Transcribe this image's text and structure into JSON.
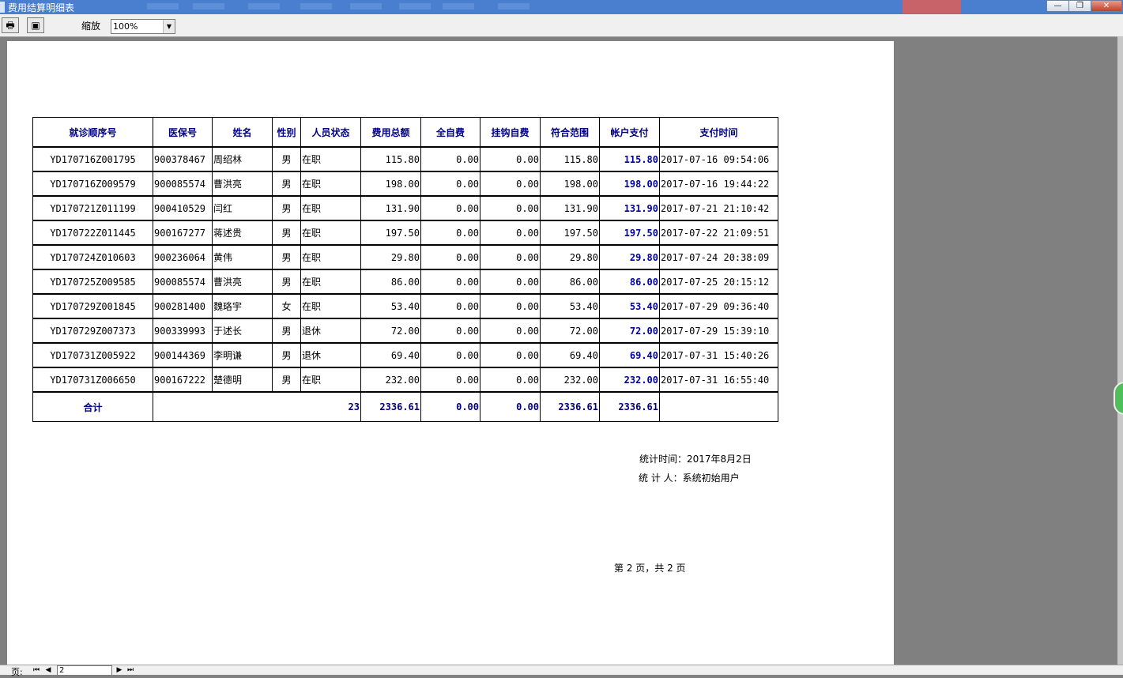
{
  "window": {
    "title": "费用结算明细表"
  },
  "toolbar": {
    "zoom_label": "缩放",
    "zoom_value": "100%"
  },
  "report": {
    "columns": [
      "就诊顺序号",
      "医保号",
      "姓名",
      "性别",
      "人员状态",
      "费用总额",
      "全自费",
      "挂钩自费",
      "符合范围",
      "帐户支付",
      "支付时间"
    ],
    "rows": [
      [
        "YD170716Z001795",
        "900378467",
        "周绍林",
        "男",
        "在职",
        "115.80",
        "0.00",
        "0.00",
        "115.80",
        "115.80",
        "2017-07-16 09:54:06"
      ],
      [
        "YD170716Z009579",
        "900085574",
        "曹洪亮",
        "男",
        "在职",
        "198.00",
        "0.00",
        "0.00",
        "198.00",
        "198.00",
        "2017-07-16 19:44:22"
      ],
      [
        "YD170721Z011199",
        "900410529",
        "闫红",
        "男",
        "在职",
        "131.90",
        "0.00",
        "0.00",
        "131.90",
        "131.90",
        "2017-07-21 21:10:42"
      ],
      [
        "YD170722Z011445",
        "900167277",
        "蒋述贵",
        "男",
        "在职",
        "197.50",
        "0.00",
        "0.00",
        "197.50",
        "197.50",
        "2017-07-22 21:09:51"
      ],
      [
        "YD170724Z010603",
        "900236064",
        "黄伟",
        "男",
        "在职",
        "29.80",
        "0.00",
        "0.00",
        "29.80",
        "29.80",
        "2017-07-24 20:38:09"
      ],
      [
        "YD170725Z009585",
        "900085574",
        "曹洪亮",
        "男",
        "在职",
        "86.00",
        "0.00",
        "0.00",
        "86.00",
        "86.00",
        "2017-07-25 20:15:12"
      ],
      [
        "YD170729Z001845",
        "900281400",
        "魏珞宇",
        "女",
        "在职",
        "53.40",
        "0.00",
        "0.00",
        "53.40",
        "53.40",
        "2017-07-29 09:36:40"
      ],
      [
        "YD170729Z007373",
        "900339993",
        "于述长",
        "男",
        "退休",
        "72.00",
        "0.00",
        "0.00",
        "72.00",
        "72.00",
        "2017-07-29 15:39:10"
      ],
      [
        "YD170731Z005922",
        "900144369",
        "李明谦",
        "男",
        "退休",
        "69.40",
        "0.00",
        "0.00",
        "69.40",
        "69.40",
        "2017-07-31 15:40:26"
      ],
      [
        "YD170731Z006650",
        "900167222",
        "楚德明",
        "男",
        "在职",
        "232.00",
        "0.00",
        "0.00",
        "232.00",
        "232.00",
        "2017-07-31 16:55:40"
      ]
    ],
    "total": {
      "label": "合计",
      "count": "23",
      "total_amount": "2336.61",
      "self_pay": "0.00",
      "linked_self_pay": "0.00",
      "in_scope": "2336.61",
      "account_pay": "2336.61"
    },
    "stat_time": "统计时间：2017年8月2日",
    "stat_person": "统 计 人：系统初始用户",
    "page_info": "第 2 页，共 2 页"
  },
  "bottom": {
    "page_label": "页:",
    "current_page": "2"
  }
}
